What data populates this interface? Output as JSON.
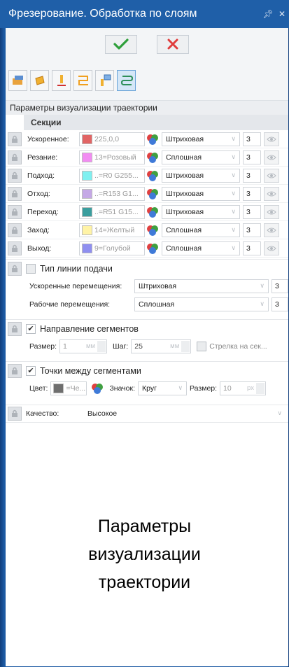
{
  "window": {
    "title": "Фрезерование. Обработка по слоям",
    "pin_icon": "pin-icon",
    "close_icon": "close-icon"
  },
  "actions": {
    "ok_icon": "checkmark-icon",
    "ok_color": "#2e9f3a",
    "cancel_icon": "cross-icon",
    "cancel_color": "#e03c3c"
  },
  "section": {
    "title": "Параметры визуализации траектории",
    "subtitle": "Секции"
  },
  "sections": [
    {
      "label": "Ускоренное:",
      "color_text": "225,0,0",
      "swatch": "#e16464",
      "line_type": "Штриховая",
      "width": "3"
    },
    {
      "label": "Резание:",
      "color_text": "13=Розовый",
      "swatch": "#f28cf2",
      "line_type": "Сплошная",
      "width": "3"
    },
    {
      "label": "Подход:",
      "color_text": "..=R0 G255...",
      "swatch": "#7ff0f0",
      "line_type": "Штриховая",
      "width": "3"
    },
    {
      "label": "Отход:",
      "color_text": "..=R153 G1...",
      "swatch": "#c5a8e6",
      "line_type": "Штриховая",
      "width": "3"
    },
    {
      "label": "Переход:",
      "color_text": "..=R51 G15...",
      "swatch": "#3a9e9e",
      "line_type": "Штриховая",
      "width": "3"
    },
    {
      "label": "Заход:",
      "color_text": "14=Желтый",
      "swatch": "#fff3a6",
      "line_type": "Сплошная",
      "width": "3"
    },
    {
      "label": "Выход:",
      "color_text": "9=Голубой",
      "swatch": "#8f8ff0",
      "line_type": "Сплошная",
      "width": "3"
    }
  ],
  "feed_line": {
    "title": "Тип линии подачи",
    "rapid_label": "Ускоренные перемещения:",
    "rapid_value": "Штриховая",
    "rapid_width": "3",
    "work_label": "Рабочие перемещения:",
    "work_value": "Сплошная",
    "work_width": "3"
  },
  "direction": {
    "title": "Направление сегментов",
    "size_label": "Размер:",
    "size_value": "1",
    "size_unit": "мм",
    "step_label": "Шаг:",
    "step_value": "25",
    "step_unit": "мм",
    "arrow_label": "Стрелка на сек..."
  },
  "points": {
    "title": "Точки между сегментами",
    "color_label": "Цвет:",
    "color_text": "=Че...",
    "color_swatch": "#6e6e6e",
    "marker_label": "Значок:",
    "marker_value": "Круг",
    "size_label": "Размер:",
    "size_value": "10",
    "size_unit": "px"
  },
  "quality": {
    "label": "Качество:",
    "value": "Высокое"
  },
  "caption": {
    "line1": "Параметры",
    "line2": "визуализации",
    "line3": "траектории"
  }
}
